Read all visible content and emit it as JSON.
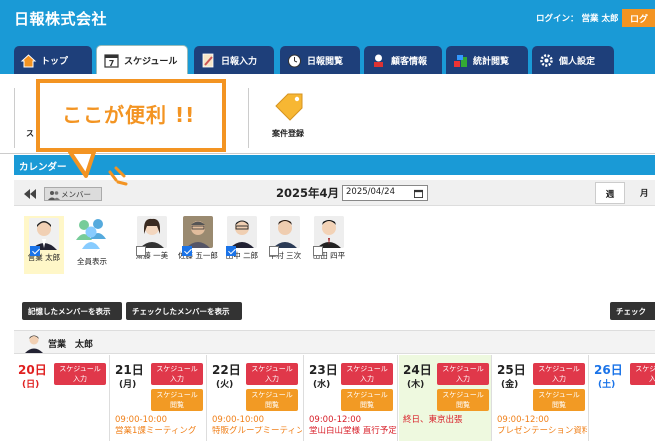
{
  "header": {
    "logo": "日報株式会社",
    "login_label": "ログイン：",
    "login_user": "営業 太郎",
    "logout_label": "ログ"
  },
  "tabs": [
    {
      "label": "トップ",
      "icon": "home-icon"
    },
    {
      "label": "スケジュール",
      "icon": "calendar-icon",
      "active": true
    },
    {
      "label": "日報入力",
      "icon": "pencil-icon"
    },
    {
      "label": "日報閲覧",
      "icon": "clock-icon"
    },
    {
      "label": "顧客情報",
      "icon": "customer-icon"
    },
    {
      "label": "統計閲覧",
      "icon": "stats-icon"
    },
    {
      "label": "個人設定",
      "icon": "gear-icon"
    }
  ],
  "toolbar": {
    "partial_left": "ス",
    "case_register": "案件登録"
  },
  "callout": {
    "text": "ここが便利 !!"
  },
  "calendar": {
    "title": "カレンダー",
    "member_button": "メンバー",
    "month": "2025年4月",
    "date_value": "2025/04/24",
    "view_week": "週",
    "view_month": "月"
  },
  "members": [
    {
      "name": "営業 太郎",
      "checked": true,
      "selected": true
    },
    {
      "name": "全員表示",
      "checked": false
    },
    {
      "name": "斎藤 一美",
      "checked": false
    },
    {
      "name": "佐藤 五一郎",
      "checked": true
    },
    {
      "name": "田中 二郎",
      "checked": true
    },
    {
      "name": "中村 三次",
      "checked": false
    },
    {
      "name": "山田 四平",
      "checked": false
    }
  ],
  "actions": {
    "show_saved": "記憶したメンバーを表示",
    "show_checked": "チェックしたメンバーを表示",
    "check_partial": "チェック"
  },
  "schedule": {
    "user": "営業　太郎",
    "input_label": "スケジュール入力",
    "view_label": "スケジュール閲覧",
    "days": [
      {
        "num": "20日",
        "wd": "(日)",
        "color": "#e02020"
      },
      {
        "num": "21日",
        "wd": "(月)",
        "color": "#222222",
        "ev_time": "09:00-10:00",
        "ev_text": "営業1課ミーティング"
      },
      {
        "num": "22日",
        "wd": "(火)",
        "color": "#222222",
        "ev_time": "09:00-10:00",
        "ev_text": "特販グループミーティング"
      },
      {
        "num": "23日",
        "wd": "(水)",
        "color": "#222222",
        "ev_time": "09:00-12:00",
        "ev_text": "堂山白山堂様 直行予定"
      },
      {
        "num": "24日",
        "wd": "(木)",
        "color": "#222222",
        "ev_text": "終日、東京出張",
        "today": true
      },
      {
        "num": "25日",
        "wd": "(金)",
        "color": "#222222",
        "ev_time": "09:00-12:00",
        "ev_text": "プレゼンテーション資料"
      },
      {
        "num": "26日",
        "wd": "(土)",
        "color": "#1a73e8"
      }
    ]
  }
}
